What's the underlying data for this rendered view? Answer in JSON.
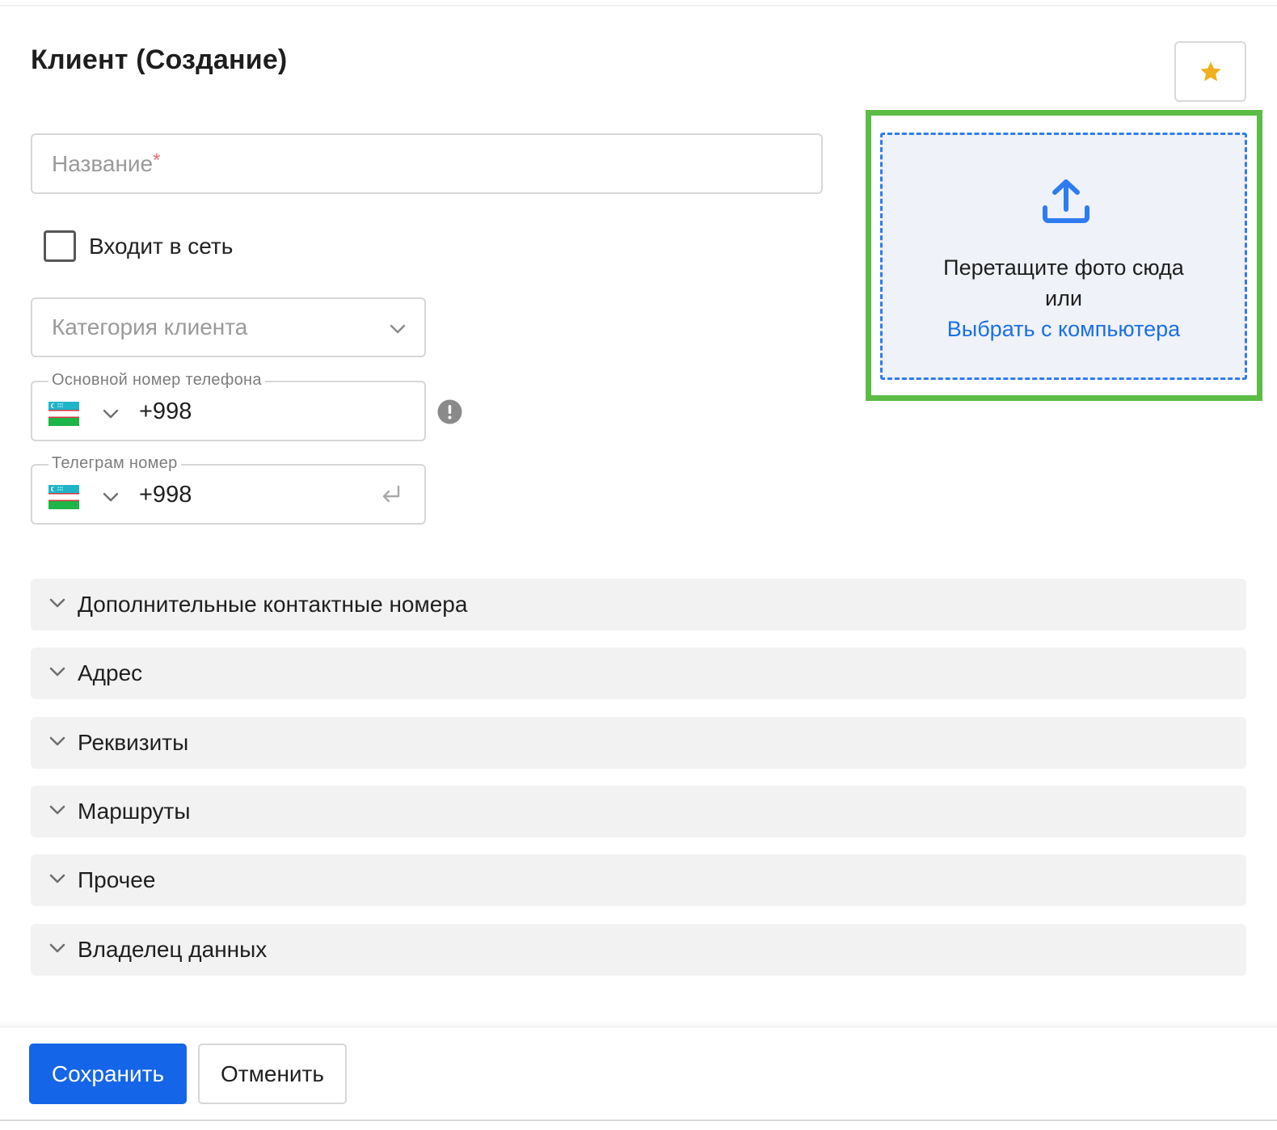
{
  "page": {
    "title": "Клиент (Создание)"
  },
  "form": {
    "name_placeholder": "Название",
    "required_mark": "*",
    "network_checkbox_label": "Входит в сеть",
    "category_placeholder": "Категория клиента",
    "main_phone": {
      "label": "Основной номер телефона",
      "code": "+998"
    },
    "telegram_phone": {
      "label": "Телеграм номер",
      "code": "+998"
    }
  },
  "upload": {
    "drop_text": "Перетащите фото сюда",
    "or_text": "или",
    "pick_link": "Выбрать с компьютера"
  },
  "sections": [
    {
      "label": "Дополнительные контактные номера"
    },
    {
      "label": "Адрес"
    },
    {
      "label": "Реквизиты"
    },
    {
      "label": "Маршруты"
    },
    {
      "label": "Прочее"
    },
    {
      "label": "Владелец данных"
    }
  ],
  "footer": {
    "save_label": "Сохранить",
    "cancel_label": "Отменить"
  },
  "colors": {
    "accent": "#1565e8",
    "link": "#1a6fe8",
    "star": "#f0b020",
    "highlight_frame": "#5bbc46",
    "upload_border": "#2f7cf0"
  },
  "icons": {
    "favorite": "star-icon",
    "upload": "upload-icon",
    "select": "chevron-down-icon",
    "flag": "uzbekistan-flag-icon",
    "info": "info-icon",
    "enter": "enter-icon"
  }
}
